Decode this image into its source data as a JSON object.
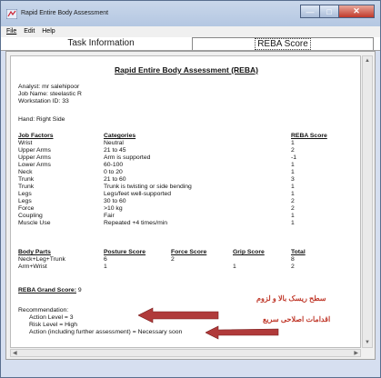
{
  "window": {
    "title": "Rapid Entire Body Assessment"
  },
  "menu": [
    "File",
    "Edit",
    "Help"
  ],
  "tabs": [
    {
      "label": "Task Information"
    },
    {
      "label": "REBA Score"
    }
  ],
  "report": {
    "title": "Rapid Entire Body Assessment (REBA)",
    "analyst": "Analyst: mr salehipoor",
    "job_name": "Job Name: steelastic R",
    "workstation": "Workstation ID: 33",
    "hand": "Hand: Right Side",
    "factors_headers": {
      "factors": "Job Factors",
      "categories": "Categories",
      "score": "REBA Score"
    },
    "factors": [
      {
        "f": "Wrist",
        "c": "Neutral",
        "s": "1"
      },
      {
        "f": "Upper Arms",
        "c": "21 to 45",
        "s": "2"
      },
      {
        "f": "Upper Arms",
        "c": "Arm is supported",
        "s": "-1"
      },
      {
        "f": "Lower Arms",
        "c": "60-100",
        "s": "1"
      },
      {
        "f": "Neck",
        "c": "0 to 20",
        "s": "1"
      },
      {
        "f": "Trunk",
        "c": "21 to 60",
        "s": "3"
      },
      {
        "f": "Trunk",
        "c": "Trunk is twisting or side bending",
        "s": "1"
      },
      {
        "f": "Legs",
        "c": "Legs/feet well-supported",
        "s": "1"
      },
      {
        "f": "Legs",
        "c": "30 to 60",
        "s": "2"
      },
      {
        "f": "Force",
        "c": ">10 kg",
        "s": "2"
      },
      {
        "f": "Coupling",
        "c": "Fair",
        "s": "1"
      },
      {
        "f": "Muscle Use",
        "c": "Repeated +4 times/min",
        "s": "1"
      }
    ],
    "parts_headers": {
      "part": "Body Parts",
      "posture": "Posture Score",
      "force": "Force Score",
      "grip": "Grip Score",
      "total": "Total"
    },
    "parts": [
      {
        "part": "Neck+Leg+Trunk",
        "posture": "6",
        "force": "2",
        "grip": "",
        "total": "8"
      },
      {
        "part": "Arm+Wrist",
        "posture": "1",
        "force": "",
        "grip": "1",
        "total": "2"
      }
    ],
    "grand_label": "REBA Grand Score:",
    "grand_value": "9",
    "recommendation": "Recommendation:",
    "action_level": "Action Level = 3",
    "risk_level": "Risk Level = High",
    "action": "Action (including further assessment) = Necessary soon"
  },
  "annotations": {
    "line1": "سطح ریسک بالا و لزوم",
    "line2": "اقدامات اصلاحی سریع"
  },
  "colors": {
    "annotation": "#c0392b",
    "arrow": "#b03a3a"
  }
}
